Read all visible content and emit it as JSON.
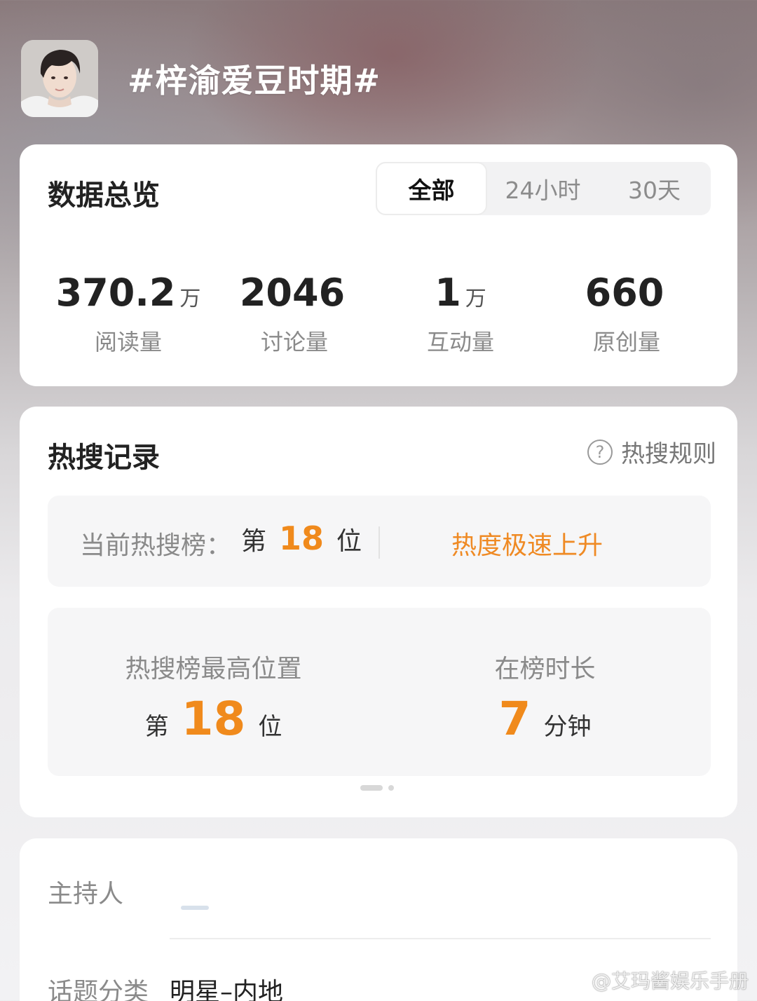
{
  "topic": {
    "title": "#梓渝爱豆时期#"
  },
  "overview": {
    "title": "数据总览",
    "tabs": [
      {
        "label": "全部",
        "active": true
      },
      {
        "label": "24小时",
        "active": false
      },
      {
        "label": "30天",
        "active": false
      }
    ],
    "stats": [
      {
        "value": "370.2",
        "unit": "万",
        "label": "阅读量"
      },
      {
        "value": "2046",
        "unit": "",
        "label": "讨论量"
      },
      {
        "value": "1",
        "unit": "万",
        "label": "互动量"
      },
      {
        "value": "660",
        "unit": "",
        "label": "原创量"
      }
    ]
  },
  "hot": {
    "title": "热搜记录",
    "rules_label": "热搜规则",
    "current_label": "当前热搜榜：",
    "rank_prefix": "第",
    "current_rank": "18",
    "rank_suffix": "位",
    "trend": "热度极速上升",
    "peak_title": "热搜榜最高位置",
    "peak_prefix": "第",
    "peak_rank": "18",
    "peak_suffix": "位",
    "duration_title": "在榜时长",
    "duration_value": "7",
    "duration_unit": "分钟"
  },
  "info": {
    "host_label": "主持人",
    "category_label": "话题分类",
    "category_value": "明星–内地"
  },
  "watermark": "@艾玛酱娱乐手册",
  "colors": {
    "accent_orange": "#f08a1c",
    "card_bg": "#ffffff",
    "panel_bg": "#f6f6f7"
  }
}
